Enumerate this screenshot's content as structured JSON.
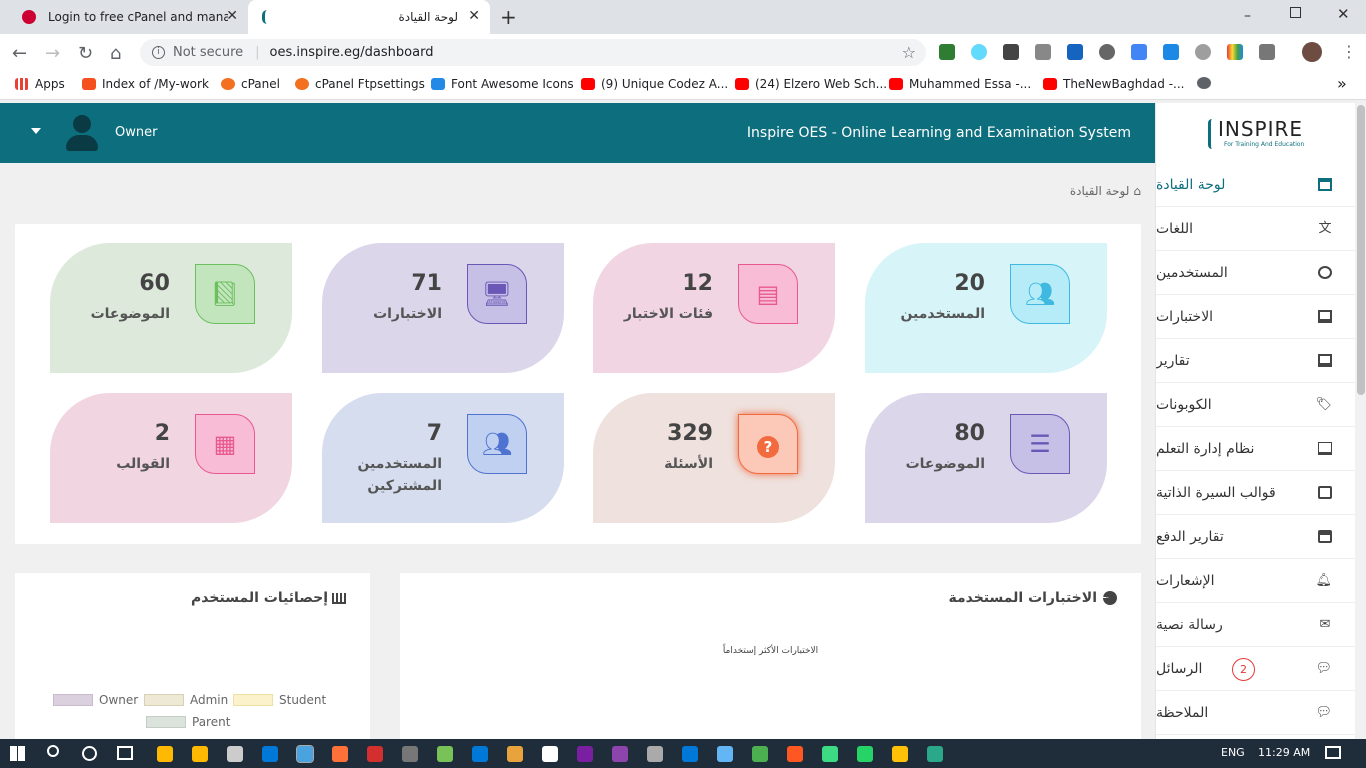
{
  "browser": {
    "tabs": [
      {
        "title": "Login to free cPanel and manage",
        "active": false
      },
      {
        "title": "لوحة القيادة",
        "active": true
      }
    ],
    "new_tab": "+",
    "not_secure": "Not secure",
    "url": "oes.inspire.eg/dashboard",
    "bookmarks": [
      {
        "label": "Apps",
        "color": "#e94235"
      },
      {
        "label": "Index of /My-work",
        "color": "#f4511e"
      },
      {
        "label": "cPanel",
        "color": "#f37021"
      },
      {
        "label": "cPanel Ftpsettings",
        "color": "#f37021"
      },
      {
        "label": "Font Awesome Icons",
        "color": "#228ae6"
      },
      {
        "label": "(9) Unique Codez A...",
        "color": "#ff0000"
      },
      {
        "label": "(24) Elzero Web Sch...",
        "color": "#ff0000"
      },
      {
        "label": "Muhammed Essa -...",
        "color": "#ff0000"
      },
      {
        "label": "TheNewBaghdad -...",
        "color": "#ff0000"
      }
    ],
    "more_bookmarks": "»"
  },
  "header": {
    "user": "Owner",
    "app_title": "Inspire OES - Online Learning and Examination System",
    "logo_text": "INSPIRE",
    "logo_sub": "For Training And Education"
  },
  "breadcrumb": "لوحة القيادة",
  "sidebar": {
    "items": [
      {
        "label": "لوحة القيادة",
        "icon": "dashboard-icon",
        "active": true
      },
      {
        "label": "اللغات",
        "icon": "language-icon"
      },
      {
        "label": "المستخدمين",
        "icon": "user-circle-icon"
      },
      {
        "label": "الاختبارات",
        "icon": "monitor-icon"
      },
      {
        "label": "تقارير",
        "icon": "monitor-icon"
      },
      {
        "label": "الكوبونات",
        "icon": "tags-icon"
      },
      {
        "label": "نظام إدارة التعلم",
        "icon": "monitor-icon"
      },
      {
        "label": "قوالب السيرة الذاتية",
        "icon": "id-card-icon"
      },
      {
        "label": "تقارير الدفع",
        "icon": "credit-card-icon"
      },
      {
        "label": "الإشعارات",
        "icon": "bell-icon"
      },
      {
        "label": "رسالة نصية",
        "icon": "envelope-icon"
      },
      {
        "label": "الرسائل",
        "icon": "comments-icon",
        "badge": "2"
      },
      {
        "label": "الملاحظة",
        "icon": "comment-icon"
      }
    ]
  },
  "stats": [
    {
      "value": "20",
      "label": "المستخدمين",
      "bg": "#d7f4f9",
      "icon_bg": "#b6ecf7",
      "icon_color": "#3fb9e0",
      "icon": "users-icon"
    },
    {
      "value": "12",
      "label": "فئات الاختبار",
      "bg": "#f1d5e2",
      "icon_bg": "#f8bcd6",
      "icon_color": "#e8598f",
      "icon": "list-alt-icon"
    },
    {
      "value": "71",
      "label": "الاختبارات",
      "bg": "#dbd6ea",
      "icon_bg": "#c6bfe6",
      "icon_color": "#6a57b6",
      "icon": "desktop-icon"
    },
    {
      "value": "60",
      "label": "الموضوعات",
      "bg": "#dce9db",
      "icon_bg": "#c2e5bd",
      "icon_color": "#6bbf5c",
      "icon": "book-icon"
    },
    {
      "value": "80",
      "label": "الموضوعات",
      "bg": "#dbd6ea",
      "icon_bg": "#c6bfe6",
      "icon_color": "#6a57b6",
      "icon": "list-icon"
    },
    {
      "value": "329",
      "label": "الأسئلة",
      "bg": "#eee1de",
      "icon_bg": "#fcc9b8",
      "icon_color": "#f26b3f",
      "icon": "question-icon"
    },
    {
      "value": "7",
      "label": "المستخدمين المشتركين",
      "bg": "#d5ddee",
      "icon_bg": "#bfd0f1",
      "icon_color": "#4e73d1",
      "icon": "users-icon"
    },
    {
      "value": "2",
      "label": "القوالب",
      "bg": "#f1d5e0",
      "icon_bg": "#f8bcd6",
      "icon_color": "#e8598f",
      "icon": "grid-icon"
    }
  ],
  "quiz_panel": {
    "title": "الاختبارات المستخدمة",
    "subtitle": "الاختبارات الأكثر إستخداماً"
  },
  "user_panel": {
    "title": "إحصائيات المستخدم",
    "legend": [
      {
        "label": "Owner",
        "color": "#dbd1de"
      },
      {
        "label": "Admin",
        "color": "#ede9d5"
      },
      {
        "label": "Student",
        "color": "#fbf2cc"
      },
      {
        "label": "Parent",
        "color": "#dbe3dc"
      }
    ]
  },
  "taskbar": {
    "lang": "ENG",
    "time": "11:29 AM"
  }
}
